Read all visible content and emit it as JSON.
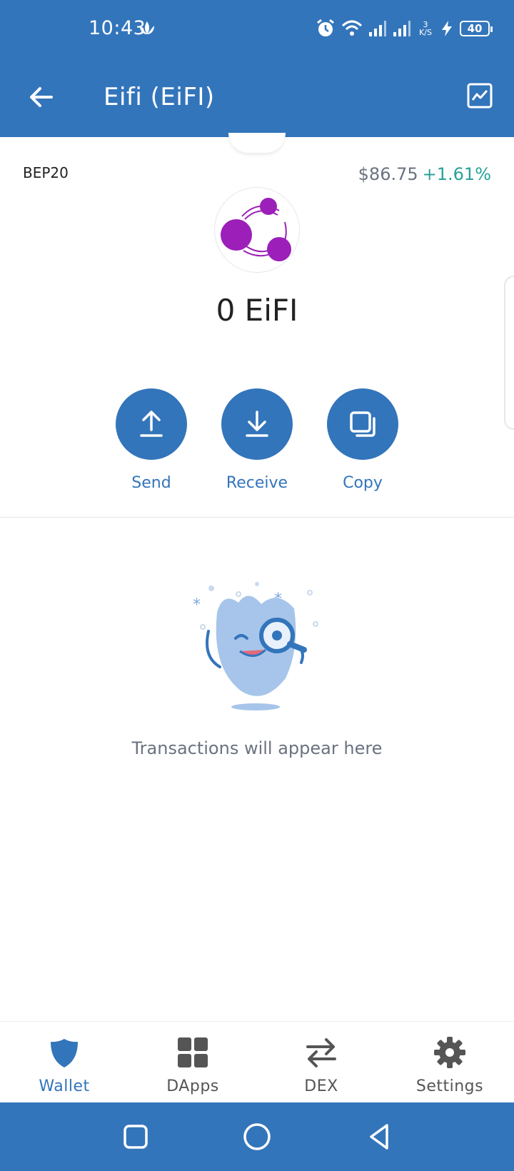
{
  "status_bar": {
    "time": "10:43",
    "net_speed_value": "3",
    "net_speed_unit": "K/S",
    "battery": "40"
  },
  "header": {
    "title": "Eifi (EiFI)"
  },
  "token": {
    "network": "BEP20",
    "price": "$86.75",
    "change": "+1.61%",
    "balance": "0 EiFI"
  },
  "actions": [
    {
      "label": "Send",
      "icon": "upload-arrow-icon"
    },
    {
      "label": "Receive",
      "icon": "download-arrow-icon"
    },
    {
      "label": "Copy",
      "icon": "copy-icon"
    }
  ],
  "empty_state": {
    "message": "Transactions will appear here"
  },
  "bottom_nav": {
    "items": [
      {
        "label": "Wallet",
        "icon": "shield-icon",
        "active": true
      },
      {
        "label": "DApps",
        "icon": "grid-icon",
        "active": false
      },
      {
        "label": "DEX",
        "icon": "swap-arrows-icon",
        "active": false
      },
      {
        "label": "Settings",
        "icon": "gear-icon",
        "active": false
      }
    ]
  },
  "colors": {
    "brand": "#3375bb",
    "positive": "#2aa198",
    "token_logo": "#9b1fb8"
  }
}
